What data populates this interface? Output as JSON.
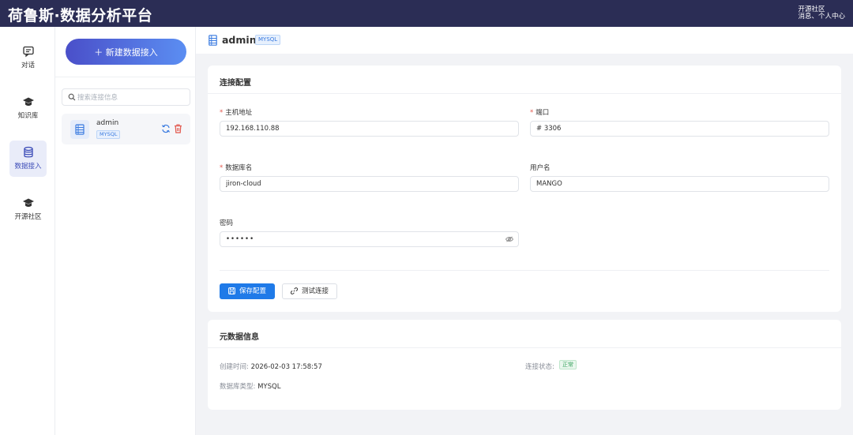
{
  "app": {
    "title": "荷鲁斯·数据分析平台",
    "links": [
      "开源社区",
      "消息、个人中心"
    ]
  },
  "nav": {
    "items": [
      {
        "label": "对话",
        "icon": "chat-icon",
        "active": false
      },
      {
        "label": "知识库",
        "icon": "graduation-cap-icon",
        "active": false
      },
      {
        "label": "数据接入",
        "icon": "database-icon",
        "active": true
      },
      {
        "label": "开源社区",
        "icon": "graduation-cap-icon",
        "active": false
      }
    ]
  },
  "panel": {
    "new_button_label": "＋ 新建数据接入",
    "search_placeholder": "搜索连接信息",
    "connections": [
      {
        "name": "admin",
        "type": "MYSQL"
      }
    ]
  },
  "header": {
    "title": "admin",
    "type_tag": "MYSQL"
  },
  "connection_config": {
    "title": "连接配置",
    "fields": {
      "host": {
        "label": "主机地址",
        "required": true,
        "value": "192.168.110.88"
      },
      "port": {
        "label": "端口",
        "required": true,
        "value": "# 3306"
      },
      "database": {
        "label": "数据库名",
        "required": true,
        "value": "jiron-cloud"
      },
      "username": {
        "label": "用户名",
        "required": false,
        "value": "MANGO"
      },
      "password": {
        "label": "密码",
        "required": false,
        "value": "••••••"
      }
    },
    "save_label": "保存配置",
    "test_label": "测试连接"
  },
  "metadata": {
    "title": "元数据信息",
    "created_label": "创建时间:",
    "created_value": "2026-02-03 17:58:57",
    "status_label": "连接状态:",
    "status_value": "正常",
    "dbtype_label": "数据库类型:",
    "dbtype_value": "MYSQL"
  },
  "colors": {
    "topbar": "#2b2d55",
    "primary": "#1f7ae8",
    "accent_gradient_start": "#4a4fc9",
    "accent_gradient_end": "#5b8ef2",
    "required": "#e2574c",
    "status_ok": "#3aa35f"
  }
}
